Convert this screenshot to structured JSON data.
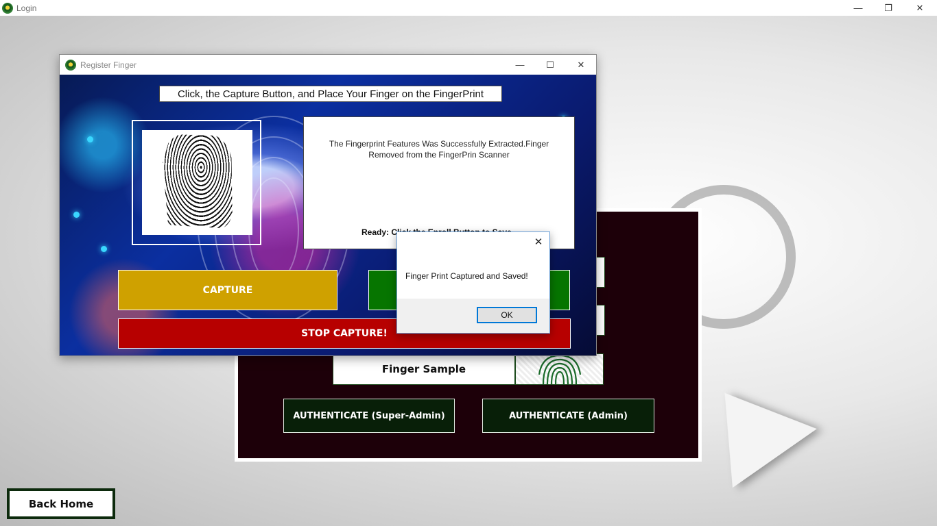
{
  "main_window": {
    "title": "Login",
    "minimize_glyph": "—",
    "restore_glyph": "❐",
    "close_glyph": "✕"
  },
  "login_panel": {
    "finger_sample_label": "Finger Sample",
    "auth_super_admin_label": "AUTHENTICATE (Super-Admin)",
    "auth_admin_label": "AUTHENTICATE (Admin)",
    "back_home_label": "Back Home"
  },
  "register_window": {
    "title": "Register Finger",
    "minimize_glyph": "—",
    "maximize_glyph": "☐",
    "close_glyph": "✕",
    "instruction": "Click, the Capture Button, and Place Your Finger on the FingerPrint",
    "status_message": "The Fingerprint Features Was Successfully Extracted.Finger Removed from the FingerPrin Scanner",
    "ready_text": "Ready: Click the Enroll Button to Save",
    "capture_label": "CAPTURE",
    "stop_capture_label": "STOP CAPTURE!"
  },
  "message_box": {
    "message": "Finger Print Captured and Saved!",
    "ok_label": "OK",
    "close_glyph": "✕"
  },
  "colors": {
    "capture": "#cfa100",
    "stop": "#b70000",
    "enroll": "#067500",
    "panel": "#1d0009"
  }
}
